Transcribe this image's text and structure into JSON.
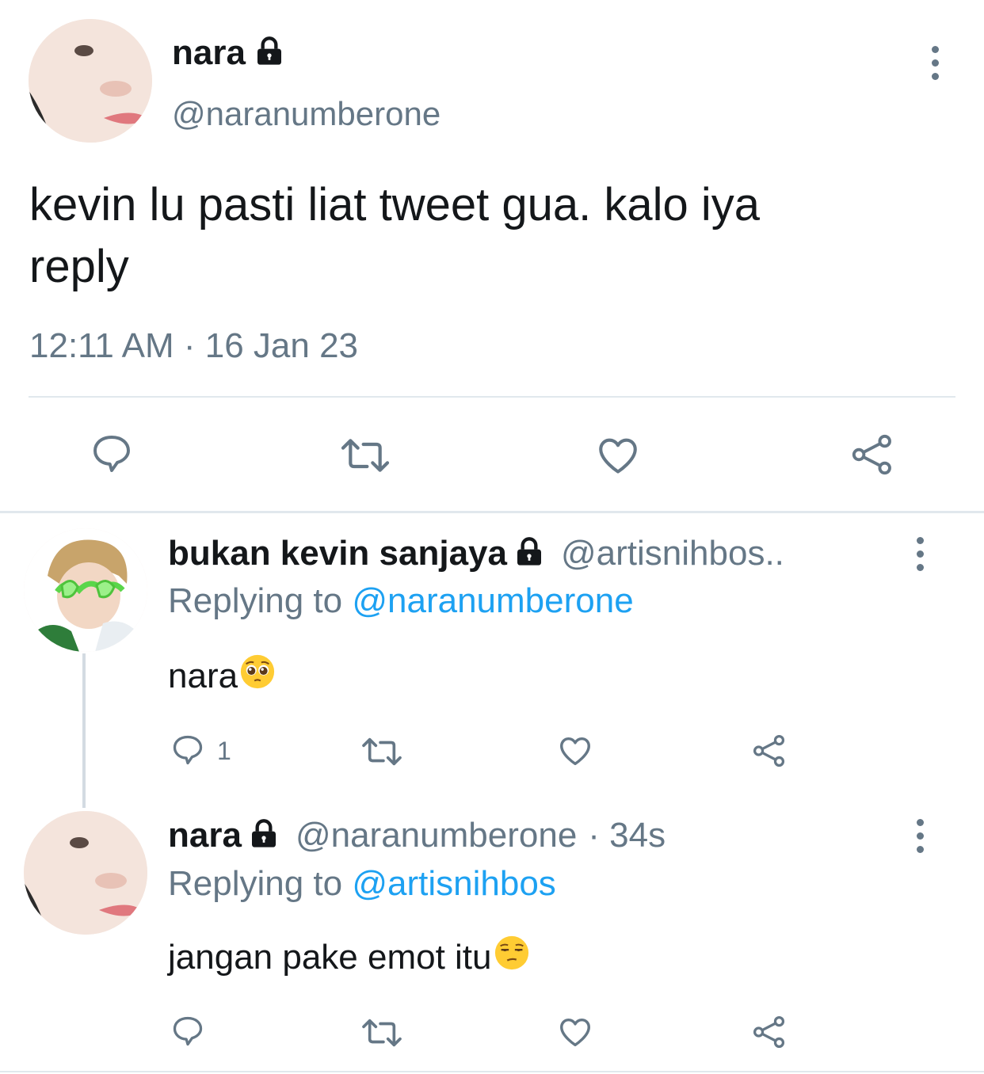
{
  "main_tweet": {
    "display_name": "nara",
    "handle": "@naranumberone",
    "text_line1": "kevin lu pasti liat tweet gua. kalo iya",
    "text_line2": "reply",
    "timestamp": "12:11 AM · 16 Jan 23"
  },
  "reply1": {
    "display_name": "bukan kevin sanjaya",
    "handle": "@artisnihbos..",
    "replying_prefix": "Replying to ",
    "replying_to": "@naranumberone",
    "text": "nara",
    "emoji": "pleading-face",
    "reply_count": "1"
  },
  "reply2": {
    "display_name": "nara",
    "handle": "@naranumberone",
    "time": "· 34s",
    "replying_prefix": "Replying to ",
    "replying_to": "@artisnihbos",
    "text": "jangan pake emot itu",
    "emoji": "unamused-face"
  },
  "colors": {
    "text": "#14171a",
    "secondary": "#657786",
    "link": "#1da1f2",
    "divider": "#e1e8ed"
  },
  "icons": [
    "lock-icon",
    "more-icon",
    "reply-icon",
    "retweet-icon",
    "like-icon",
    "share-icon"
  ]
}
